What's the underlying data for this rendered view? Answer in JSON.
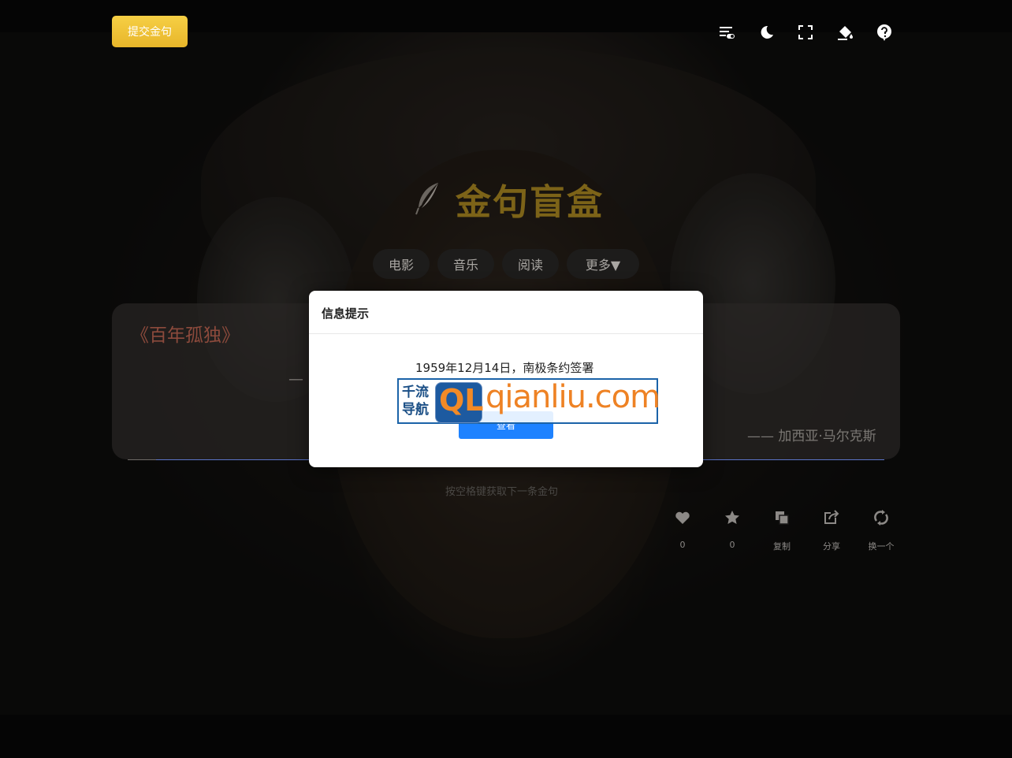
{
  "header": {
    "submit_label": "提交金句",
    "tools": [
      "list-toggle-icon",
      "moon-icon",
      "fullscreen-icon",
      "paint-bucket-icon",
      "help-icon"
    ]
  },
  "brand": {
    "title": "金句盲盒",
    "icon": "feather-icon"
  },
  "categories": [
    "电影",
    "音乐",
    "阅读",
    "更多▼"
  ],
  "quote": {
    "book": "《百年孤独》",
    "text_start": "—",
    "text_end": "。",
    "author": "—— 加西亚·马尔克斯"
  },
  "hint": "按空格键获取下一条金句",
  "actions": [
    {
      "icon": "heart-icon",
      "label": "0"
    },
    {
      "icon": "star-icon",
      "label": "0"
    },
    {
      "icon": "copy-icon",
      "label": "复制"
    },
    {
      "icon": "share-icon",
      "label": "分享"
    },
    {
      "icon": "refresh-icon",
      "label": "换一个"
    }
  ],
  "modal": {
    "title": "信息提示",
    "message": "1959年12月14日，南极条约签署",
    "button_label": "查看"
  },
  "watermark": {
    "chinese": "千流导航",
    "logo_letters": "QL",
    "url": "qianliu.com"
  },
  "colors": {
    "accent": "#f0c035",
    "brand_title": "#7c6318",
    "book_title": "#8c4a3c",
    "modal_button": "#1e82ff"
  }
}
